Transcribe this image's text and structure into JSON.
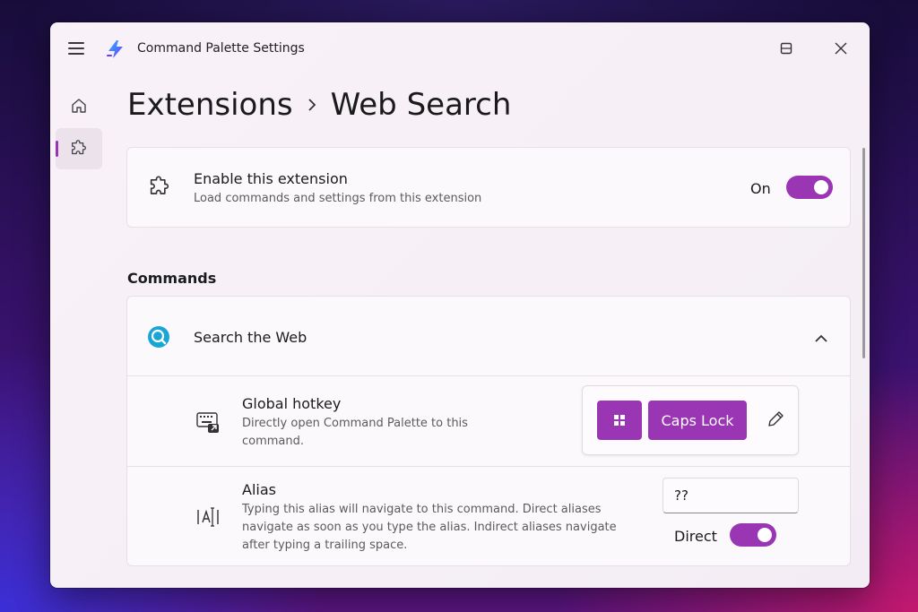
{
  "app": {
    "title": "Command Palette Settings",
    "icons": {
      "menu": "hamburger-icon",
      "app": "command-palette-bolt-icon",
      "minimize": "minimize-icon",
      "maximize": "maximize-icon",
      "close": "close-icon"
    }
  },
  "nav": {
    "items": [
      {
        "icon": "home-icon",
        "selected": false
      },
      {
        "icon": "extensions-puzzle-icon",
        "selected": true
      }
    ]
  },
  "breadcrumb": {
    "root": "Extensions",
    "current": "Web Search"
  },
  "enable_card": {
    "title": "Enable this extension",
    "subtitle": "Load commands and settings from this extension",
    "state_label": "On",
    "toggle_on": true
  },
  "commands": {
    "heading": "Commands",
    "command": {
      "title": "Search the Web",
      "expanded": true,
      "hotkey": {
        "title": "Global hotkey",
        "subtitle": "Directly open Command Palette to this command.",
        "keys": [
          "Win",
          "Caps Lock"
        ],
        "caps_label": "Caps Lock"
      },
      "alias": {
        "title": "Alias",
        "subtitle": "Typing this alias will navigate to this command. Direct aliases navigate as soon as you type the alias. Indirect aliases navigate after typing a trailing space.",
        "value": "??",
        "direct_label": "Direct",
        "direct_on": true
      }
    }
  },
  "colors": {
    "accent": "#9a35b3",
    "window_bg": "#f7f0f7",
    "card_bg": "#fcf9fc"
  }
}
